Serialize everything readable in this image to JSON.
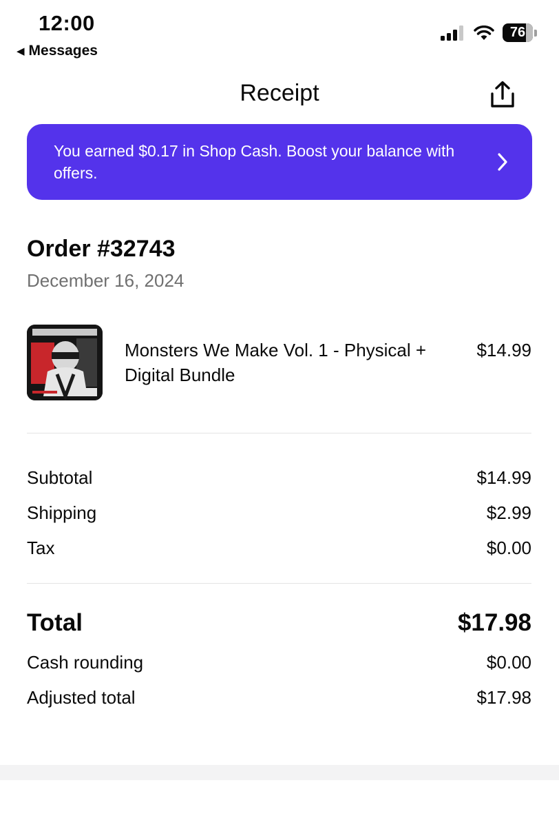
{
  "status_bar": {
    "time": "12:00",
    "back_label": "Messages",
    "battery": "76",
    "icons": [
      "cellular-signal-icon",
      "wifi-icon",
      "battery-icon"
    ]
  },
  "header": {
    "title": "Receipt",
    "share_icon": "share-upload-icon"
  },
  "promo": {
    "text": "You earned $0.17 in Shop Cash. Boost your balance with offers.",
    "chevron_icon": "chevron-right-icon",
    "color": "#5433EB"
  },
  "order": {
    "number": "Order #32743",
    "date": "December 16, 2024"
  },
  "items": [
    {
      "name": "Monsters We Make Vol. 1 - Physical + Digital Bundle",
      "price": "$14.99",
      "thumbnail": "album-cover-image"
    }
  ],
  "summary": {
    "subtotal_label": "Subtotal",
    "subtotal_value": "$14.99",
    "shipping_label": "Shipping",
    "shipping_value": "$2.99",
    "tax_label": "Tax",
    "tax_value": "$0.00"
  },
  "totals": {
    "total_label": "Total",
    "total_value": "$17.98",
    "rounding_label": "Cash rounding",
    "rounding_value": "$0.00",
    "adjusted_label": "Adjusted total",
    "adjusted_value": "$17.98"
  }
}
